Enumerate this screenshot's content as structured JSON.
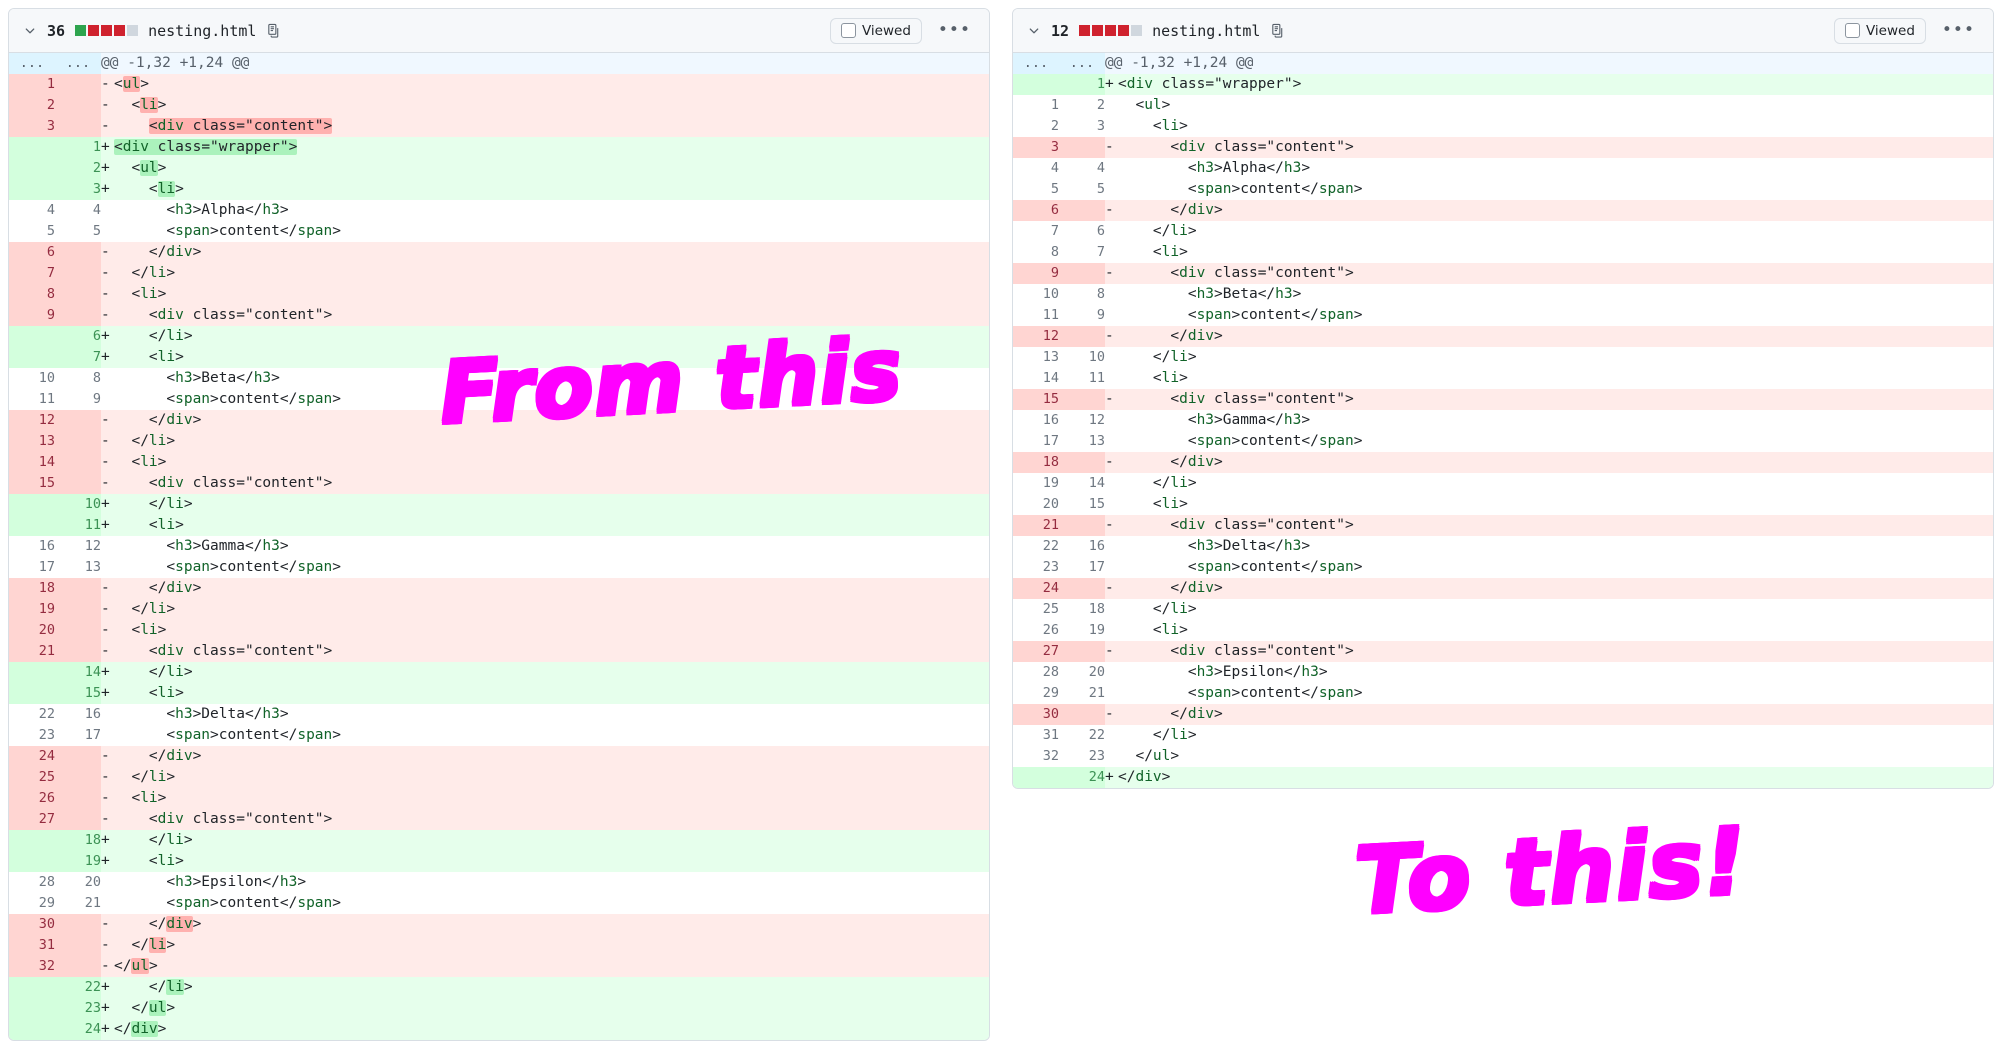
{
  "panels": [
    {
      "id": "left",
      "header": {
        "collapse_icon": "chevron-down-icon",
        "change_count": "36",
        "diffstat": [
          "#2da44e",
          "#cf222e",
          "#cf222e",
          "#cf222e",
          "#d0d7de"
        ],
        "filename": "nesting.html",
        "copy_icon": "copy-path-icon",
        "viewed_label": "Viewed",
        "kebab_label": "•••"
      },
      "hunk": {
        "old": "...",
        "new": "...",
        "text": "@@ -1,32 +1,24 @@"
      },
      "rows": [
        {
          "type": "del",
          "old": "1",
          "new": "",
          "sign": "-",
          "code": "<ul>",
          "indent": 0,
          "hl": "word"
        },
        {
          "type": "del",
          "old": "2",
          "new": "",
          "sign": "-",
          "code": "<li>",
          "indent": 1,
          "hl": "word"
        },
        {
          "type": "del",
          "old": "3",
          "new": "",
          "sign": "-",
          "code": "<div class=\"content\">",
          "indent": 2,
          "hl": "full"
        },
        {
          "type": "add",
          "old": "",
          "new": "1",
          "sign": "+",
          "code": "<div class=\"wrapper\">",
          "indent": 0,
          "hl": "full"
        },
        {
          "type": "add",
          "old": "",
          "new": "2",
          "sign": "+",
          "code": "<ul>",
          "indent": 1,
          "hl": "word"
        },
        {
          "type": "add",
          "old": "",
          "new": "3",
          "sign": "+",
          "code": "<li>",
          "indent": 2,
          "hl": "word"
        },
        {
          "type": "ctx",
          "old": "4",
          "new": "4",
          "sign": " ",
          "code": "<h3>Alpha</h3>",
          "indent": 3,
          "hl": "none"
        },
        {
          "type": "ctx",
          "old": "5",
          "new": "5",
          "sign": " ",
          "code": "<span>content</span>",
          "indent": 3,
          "hl": "none"
        },
        {
          "type": "del",
          "old": "6",
          "new": "",
          "sign": "-",
          "code": "</div>",
          "indent": 2,
          "hl": "none"
        },
        {
          "type": "del",
          "old": "7",
          "new": "",
          "sign": "-",
          "code": "</li>",
          "indent": 1,
          "hl": "none"
        },
        {
          "type": "del",
          "old": "8",
          "new": "",
          "sign": "-",
          "code": "<li>",
          "indent": 1,
          "hl": "none"
        },
        {
          "type": "del",
          "old": "9",
          "new": "",
          "sign": "-",
          "code": "<div class=\"content\">",
          "indent": 2,
          "hl": "none"
        },
        {
          "type": "add",
          "old": "",
          "new": "6",
          "sign": "+",
          "code": "</li>",
          "indent": 2,
          "hl": "none"
        },
        {
          "type": "add",
          "old": "",
          "new": "7",
          "sign": "+",
          "code": "<li>",
          "indent": 2,
          "hl": "none"
        },
        {
          "type": "ctx",
          "old": "10",
          "new": "8",
          "sign": " ",
          "code": "<h3>Beta</h3>",
          "indent": 3,
          "hl": "none"
        },
        {
          "type": "ctx",
          "old": "11",
          "new": "9",
          "sign": " ",
          "code": "<span>content</span>",
          "indent": 3,
          "hl": "none"
        },
        {
          "type": "del",
          "old": "12",
          "new": "",
          "sign": "-",
          "code": "</div>",
          "indent": 2,
          "hl": "none"
        },
        {
          "type": "del",
          "old": "13",
          "new": "",
          "sign": "-",
          "code": "</li>",
          "indent": 1,
          "hl": "none"
        },
        {
          "type": "del",
          "old": "14",
          "new": "",
          "sign": "-",
          "code": "<li>",
          "indent": 1,
          "hl": "none"
        },
        {
          "type": "del",
          "old": "15",
          "new": "",
          "sign": "-",
          "code": "<div class=\"content\">",
          "indent": 2,
          "hl": "none"
        },
        {
          "type": "add",
          "old": "",
          "new": "10",
          "sign": "+",
          "code": "</li>",
          "indent": 2,
          "hl": "none"
        },
        {
          "type": "add",
          "old": "",
          "new": "11",
          "sign": "+",
          "code": "<li>",
          "indent": 2,
          "hl": "none"
        },
        {
          "type": "ctx",
          "old": "16",
          "new": "12",
          "sign": " ",
          "code": "<h3>Gamma</h3>",
          "indent": 3,
          "hl": "none"
        },
        {
          "type": "ctx",
          "old": "17",
          "new": "13",
          "sign": " ",
          "code": "<span>content</span>",
          "indent": 3,
          "hl": "none"
        },
        {
          "type": "del",
          "old": "18",
          "new": "",
          "sign": "-",
          "code": "</div>",
          "indent": 2,
          "hl": "none"
        },
        {
          "type": "del",
          "old": "19",
          "new": "",
          "sign": "-",
          "code": "</li>",
          "indent": 1,
          "hl": "none"
        },
        {
          "type": "del",
          "old": "20",
          "new": "",
          "sign": "-",
          "code": "<li>",
          "indent": 1,
          "hl": "none"
        },
        {
          "type": "del",
          "old": "21",
          "new": "",
          "sign": "-",
          "code": "<div class=\"content\">",
          "indent": 2,
          "hl": "none"
        },
        {
          "type": "add",
          "old": "",
          "new": "14",
          "sign": "+",
          "code": "</li>",
          "indent": 2,
          "hl": "none"
        },
        {
          "type": "add",
          "old": "",
          "new": "15",
          "sign": "+",
          "code": "<li>",
          "indent": 2,
          "hl": "none"
        },
        {
          "type": "ctx",
          "old": "22",
          "new": "16",
          "sign": " ",
          "code": "<h3>Delta</h3>",
          "indent": 3,
          "hl": "none"
        },
        {
          "type": "ctx",
          "old": "23",
          "new": "17",
          "sign": " ",
          "code": "<span>content</span>",
          "indent": 3,
          "hl": "none"
        },
        {
          "type": "del",
          "old": "24",
          "new": "",
          "sign": "-",
          "code": "</div>",
          "indent": 2,
          "hl": "none"
        },
        {
          "type": "del",
          "old": "25",
          "new": "",
          "sign": "-",
          "code": "</li>",
          "indent": 1,
          "hl": "none"
        },
        {
          "type": "del",
          "old": "26",
          "new": "",
          "sign": "-",
          "code": "<li>",
          "indent": 1,
          "hl": "none"
        },
        {
          "type": "del",
          "old": "27",
          "new": "",
          "sign": "-",
          "code": "<div class=\"content\">",
          "indent": 2,
          "hl": "none"
        },
        {
          "type": "add",
          "old": "",
          "new": "18",
          "sign": "+",
          "code": "</li>",
          "indent": 2,
          "hl": "none"
        },
        {
          "type": "add",
          "old": "",
          "new": "19",
          "sign": "+",
          "code": "<li>",
          "indent": 2,
          "hl": "none"
        },
        {
          "type": "ctx",
          "old": "28",
          "new": "20",
          "sign": " ",
          "code": "<h3>Epsilon</h3>",
          "indent": 3,
          "hl": "none"
        },
        {
          "type": "ctx",
          "old": "29",
          "new": "21",
          "sign": " ",
          "code": "<span>content</span>",
          "indent": 3,
          "hl": "none"
        },
        {
          "type": "del",
          "old": "30",
          "new": "",
          "sign": "-",
          "code": "</div>",
          "indent": 2,
          "hl": "word"
        },
        {
          "type": "del",
          "old": "31",
          "new": "",
          "sign": "-",
          "code": "</li>",
          "indent": 1,
          "hl": "word"
        },
        {
          "type": "del",
          "old": "32",
          "new": "",
          "sign": "-",
          "code": "</ul>",
          "indent": 0,
          "hl": "word"
        },
        {
          "type": "add",
          "old": "",
          "new": "22",
          "sign": "+",
          "code": "</li>",
          "indent": 2,
          "hl": "word"
        },
        {
          "type": "add",
          "old": "",
          "new": "23",
          "sign": "+",
          "code": "</ul>",
          "indent": 1,
          "hl": "word"
        },
        {
          "type": "add",
          "old": "",
          "new": "24",
          "sign": "+",
          "code": "</div>",
          "indent": 0,
          "hl": "word"
        }
      ]
    },
    {
      "id": "right",
      "header": {
        "collapse_icon": "chevron-down-icon",
        "change_count": "12",
        "diffstat": [
          "#cf222e",
          "#cf222e",
          "#cf222e",
          "#cf222e",
          "#d0d7de"
        ],
        "filename": "nesting.html",
        "copy_icon": "copy-path-icon",
        "viewed_label": "Viewed",
        "kebab_label": "•••"
      },
      "hunk": {
        "old": "...",
        "new": "...",
        "text": "@@ -1,32 +1,24 @@"
      },
      "rows": [
        {
          "type": "add",
          "old": "",
          "new": "1",
          "sign": "+",
          "code": "<div class=\"wrapper\">",
          "indent": 0,
          "hl": "none"
        },
        {
          "type": "ctx",
          "old": "1",
          "new": "2",
          "sign": " ",
          "code": "<ul>",
          "indent": 1,
          "hl": "none"
        },
        {
          "type": "ctx",
          "old": "2",
          "new": "3",
          "sign": " ",
          "code": "<li>",
          "indent": 2,
          "hl": "none"
        },
        {
          "type": "del",
          "old": "3",
          "new": "",
          "sign": "-",
          "code": "<div class=\"content\">",
          "indent": 3,
          "hl": "none"
        },
        {
          "type": "ctx",
          "old": "4",
          "new": "4",
          "sign": " ",
          "code": "<h3>Alpha</h3>",
          "indent": 4,
          "hl": "none"
        },
        {
          "type": "ctx",
          "old": "5",
          "new": "5",
          "sign": " ",
          "code": "<span>content</span>",
          "indent": 4,
          "hl": "none"
        },
        {
          "type": "del",
          "old": "6",
          "new": "",
          "sign": "-",
          "code": "</div>",
          "indent": 3,
          "hl": "none"
        },
        {
          "type": "ctx",
          "old": "7",
          "new": "6",
          "sign": " ",
          "code": "</li>",
          "indent": 2,
          "hl": "none"
        },
        {
          "type": "ctx",
          "old": "8",
          "new": "7",
          "sign": " ",
          "code": "<li>",
          "indent": 2,
          "hl": "none"
        },
        {
          "type": "del",
          "old": "9",
          "new": "",
          "sign": "-",
          "code": "<div class=\"content\">",
          "indent": 3,
          "hl": "none"
        },
        {
          "type": "ctx",
          "old": "10",
          "new": "8",
          "sign": " ",
          "code": "<h3>Beta</h3>",
          "indent": 4,
          "hl": "none"
        },
        {
          "type": "ctx",
          "old": "11",
          "new": "9",
          "sign": " ",
          "code": "<span>content</span>",
          "indent": 4,
          "hl": "none"
        },
        {
          "type": "del",
          "old": "12",
          "new": "",
          "sign": "-",
          "code": "</div>",
          "indent": 3,
          "hl": "none"
        },
        {
          "type": "ctx",
          "old": "13",
          "new": "10",
          "sign": " ",
          "code": "</li>",
          "indent": 2,
          "hl": "none"
        },
        {
          "type": "ctx",
          "old": "14",
          "new": "11",
          "sign": " ",
          "code": "<li>",
          "indent": 2,
          "hl": "none"
        },
        {
          "type": "del",
          "old": "15",
          "new": "",
          "sign": "-",
          "code": "<div class=\"content\">",
          "indent": 3,
          "hl": "none"
        },
        {
          "type": "ctx",
          "old": "16",
          "new": "12",
          "sign": " ",
          "code": "<h3>Gamma</h3>",
          "indent": 4,
          "hl": "none"
        },
        {
          "type": "ctx",
          "old": "17",
          "new": "13",
          "sign": " ",
          "code": "<span>content</span>",
          "indent": 4,
          "hl": "none"
        },
        {
          "type": "del",
          "old": "18",
          "new": "",
          "sign": "-",
          "code": "</div>",
          "indent": 3,
          "hl": "none"
        },
        {
          "type": "ctx",
          "old": "19",
          "new": "14",
          "sign": " ",
          "code": "</li>",
          "indent": 2,
          "hl": "none"
        },
        {
          "type": "ctx",
          "old": "20",
          "new": "15",
          "sign": " ",
          "code": "<li>",
          "indent": 2,
          "hl": "none"
        },
        {
          "type": "del",
          "old": "21",
          "new": "",
          "sign": "-",
          "code": "<div class=\"content\">",
          "indent": 3,
          "hl": "none"
        },
        {
          "type": "ctx",
          "old": "22",
          "new": "16",
          "sign": " ",
          "code": "<h3>Delta</h3>",
          "indent": 4,
          "hl": "none"
        },
        {
          "type": "ctx",
          "old": "23",
          "new": "17",
          "sign": " ",
          "code": "<span>content</span>",
          "indent": 4,
          "hl": "none"
        },
        {
          "type": "del",
          "old": "24",
          "new": "",
          "sign": "-",
          "code": "</div>",
          "indent": 3,
          "hl": "none"
        },
        {
          "type": "ctx",
          "old": "25",
          "new": "18",
          "sign": " ",
          "code": "</li>",
          "indent": 2,
          "hl": "none"
        },
        {
          "type": "ctx",
          "old": "26",
          "new": "19",
          "sign": " ",
          "code": "<li>",
          "indent": 2,
          "hl": "none"
        },
        {
          "type": "del",
          "old": "27",
          "new": "",
          "sign": "-",
          "code": "<div class=\"content\">",
          "indent": 3,
          "hl": "none"
        },
        {
          "type": "ctx",
          "old": "28",
          "new": "20",
          "sign": " ",
          "code": "<h3>Epsilon</h3>",
          "indent": 4,
          "hl": "none"
        },
        {
          "type": "ctx",
          "old": "29",
          "new": "21",
          "sign": " ",
          "code": "<span>content</span>",
          "indent": 4,
          "hl": "none"
        },
        {
          "type": "del",
          "old": "30",
          "new": "",
          "sign": "-",
          "code": "</div>",
          "indent": 3,
          "hl": "none"
        },
        {
          "type": "ctx",
          "old": "31",
          "new": "22",
          "sign": " ",
          "code": "</li>",
          "indent": 2,
          "hl": "none"
        },
        {
          "type": "ctx",
          "old": "32",
          "new": "23",
          "sign": " ",
          "code": "</ul>",
          "indent": 1,
          "hl": "none"
        },
        {
          "type": "add",
          "old": "",
          "new": "24",
          "sign": "+",
          "code": "</div>",
          "indent": 0,
          "hl": "none"
        }
      ]
    }
  ],
  "annotations": {
    "from_this": "From this",
    "to_this": "To this!",
    "color": "#ff00ff"
  }
}
